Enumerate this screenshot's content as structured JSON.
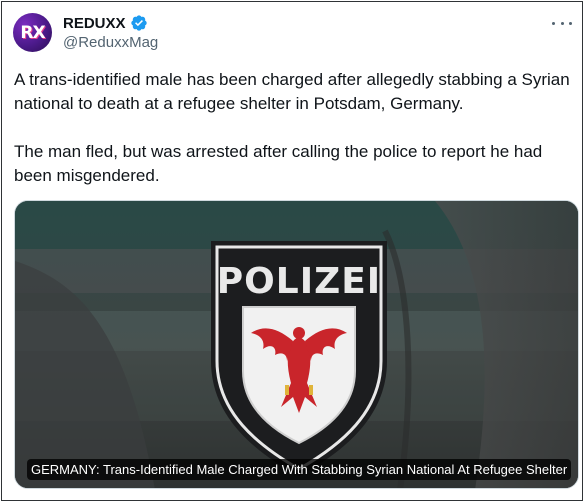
{
  "author": {
    "display_name": "REDUXX",
    "handle": "@ReduxxMag",
    "avatar_text": "RX",
    "verified": true,
    "verified_color": "#1d9bf0"
  },
  "tweet": {
    "paragraphs": [
      "A trans-identified male has been charged after allegedly stabbing a Syrian national to death at a refugee shelter in Potsdam, Germany.",
      "The man fled, but was arrested after calling the police to report he had been misgendered."
    ]
  },
  "media": {
    "patch_text": "POLIZEI",
    "caption": "GERMANY: Trans-Identified Male Charged With Stabbing Syrian National At Refugee Shelter"
  },
  "icons": {
    "more": "more-options-icon",
    "verified": "verified-badge-icon"
  }
}
